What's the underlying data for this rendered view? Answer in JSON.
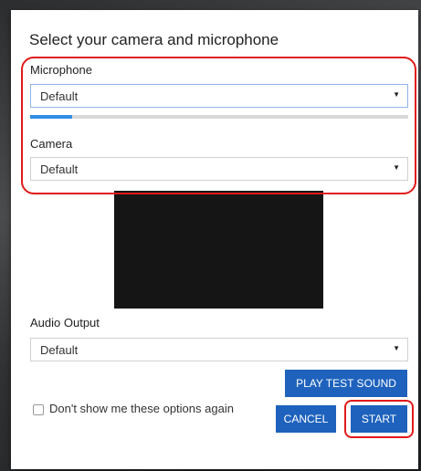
{
  "dialog": {
    "title": "Select your camera and microphone",
    "microphone": {
      "label": "Microphone",
      "value": "Default",
      "level": 0.11
    },
    "camera": {
      "label": "Camera",
      "value": "Default"
    },
    "audio_output": {
      "label": "Audio Output",
      "value": "Default"
    },
    "play_test_sound_label": "PLAY TEST SOUND",
    "dont_show_label": "Don't show me these options again",
    "dont_show_checked": false,
    "cancel_label": "CANCEL",
    "start_label": "START"
  },
  "icons": {
    "dropdown": "chevron-down-icon"
  },
  "colors": {
    "primary_button": "#1e62bd",
    "highlight": "#e01a1a",
    "meter_fill": "#2f8de4"
  }
}
